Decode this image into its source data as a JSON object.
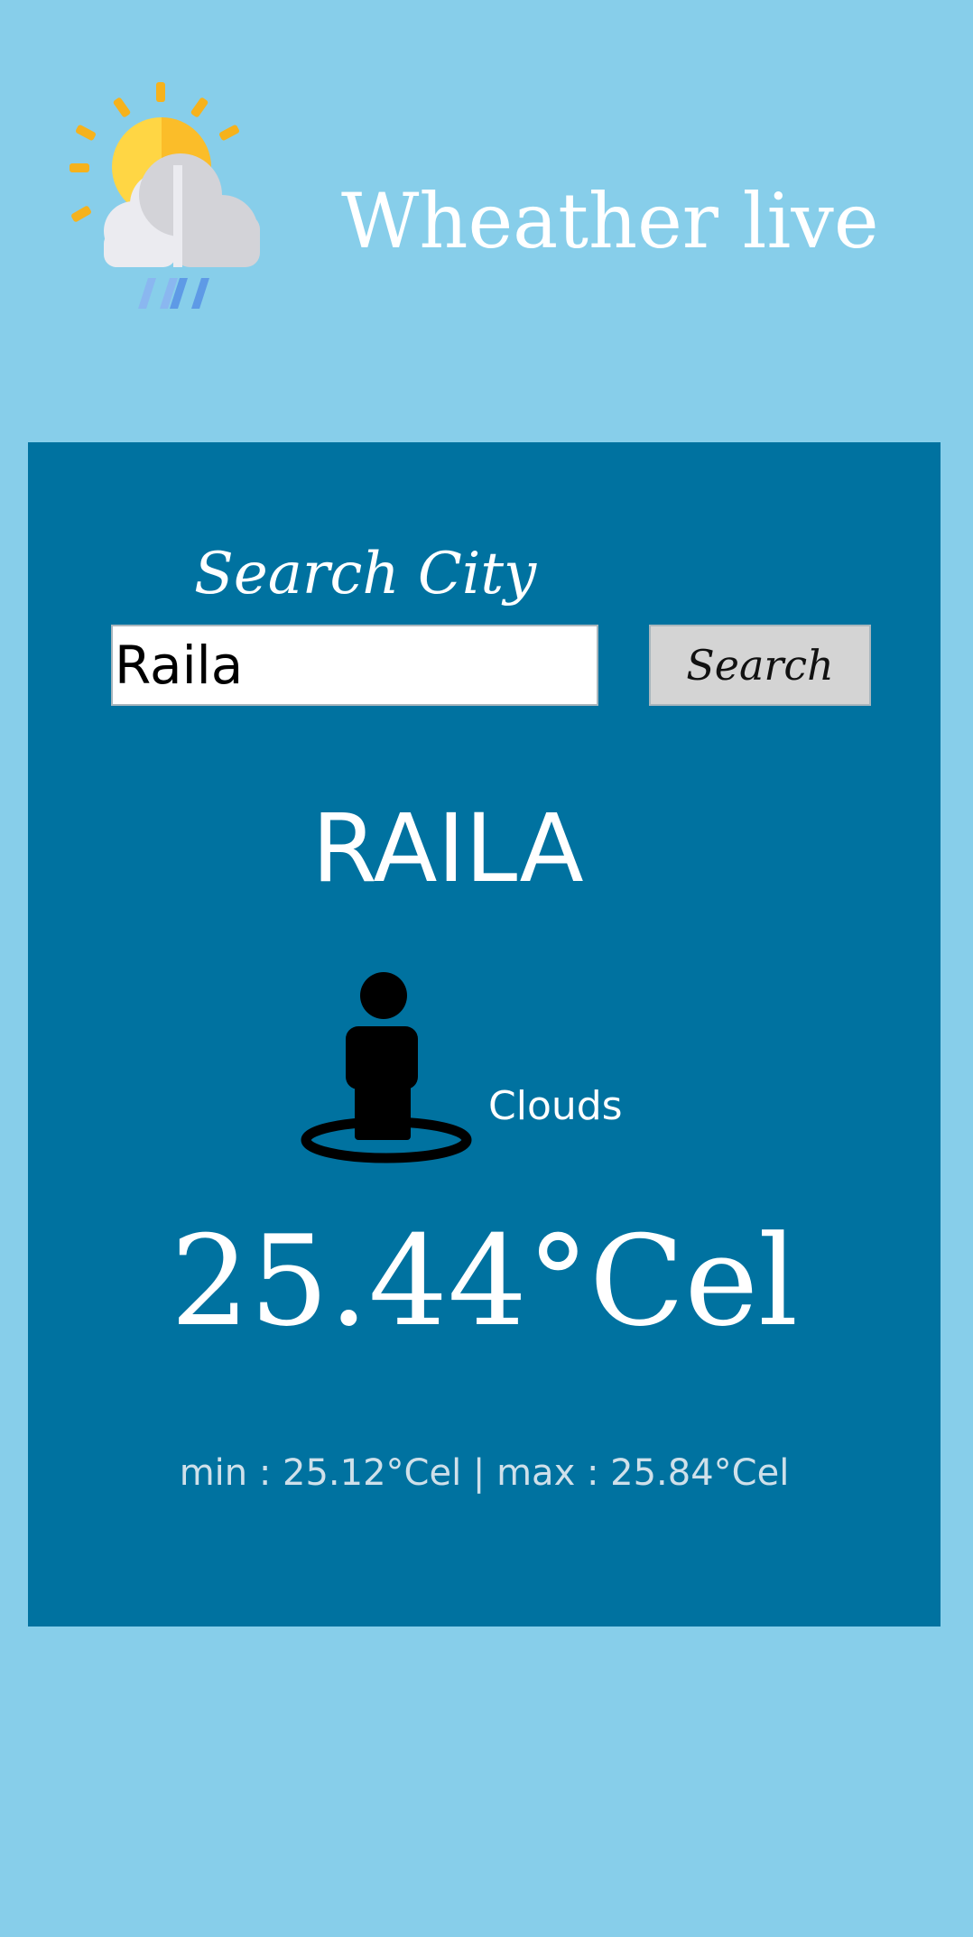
{
  "header": {
    "logo_icon": "sun-cloud-rain-icon",
    "title": "Wheather live"
  },
  "search": {
    "label": "Search City",
    "input_value": "Raila",
    "button_label": "Search"
  },
  "weather": {
    "city": "RAILA",
    "icon": "person-location-icon",
    "description": "Clouds",
    "temperature": "25.44°Cel",
    "min_max": "min : 25.12°Cel | max : 25.84°Cel"
  },
  "colors": {
    "page_background": "#87ceea",
    "card_background": "#0072a0",
    "button_background": "#d4d4d4",
    "text": "#ffffff"
  }
}
